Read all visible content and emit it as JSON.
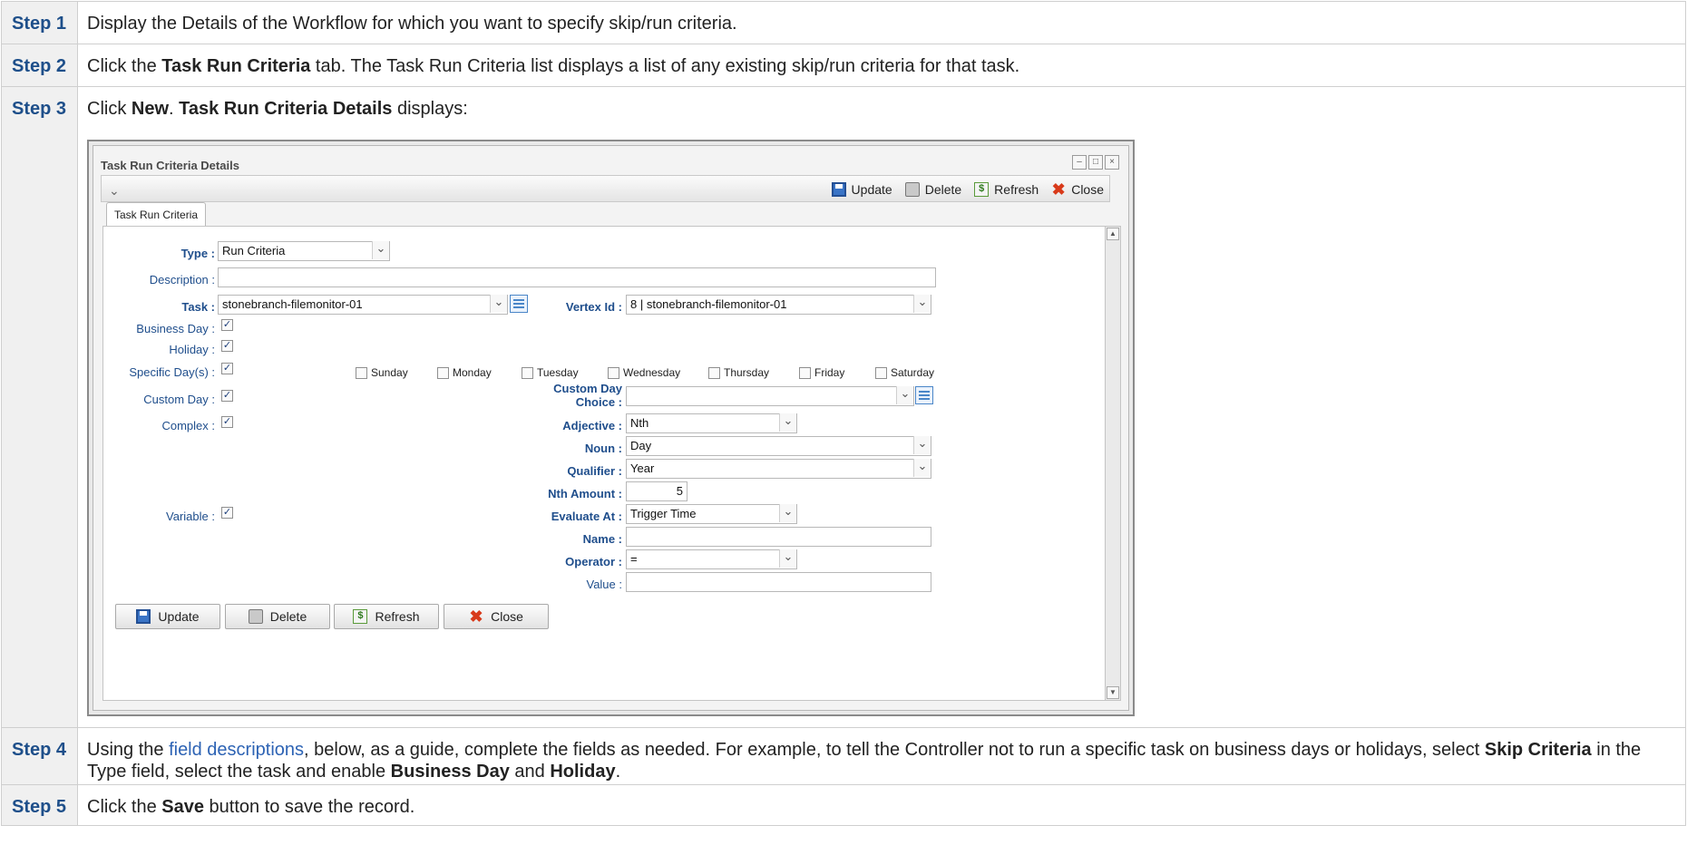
{
  "steps": [
    {
      "label": "Step 1",
      "text": "Display the Details of the Workflow for which you want to specify skip/run criteria."
    },
    {
      "label": "Step 2",
      "pre": "Click the ",
      "bold": "Task Run Criteria",
      "post": " tab. The Task Run Criteria list displays a list of any existing skip/run criteria for that task."
    },
    {
      "label": "Step 3",
      "pre": "Click ",
      "bold1": "New",
      "mid": ". ",
      "bold2": "Task Run Criteria Details",
      "post": " displays:"
    },
    {
      "label": "Step 4",
      "pre": "Using the ",
      "link": "field descriptions",
      "mid1": ", below, as a guide, complete the fields as needed. For example, to tell the Controller not to run a specific task on business days or holidays, select ",
      "bold1": "Skip Criteria",
      "mid2": " in the Type field, select the task and enable ",
      "bold2": "Business Day",
      "mid3": " and ",
      "bold3": "Holiday",
      "post": "."
    },
    {
      "label": "Step 5",
      "pre": "Click the ",
      "bold": "Save",
      "post": " button to save the record."
    }
  ],
  "window": {
    "title": "Task Run Criteria Details",
    "toolbar": {
      "update": "Update",
      "delete": "Delete",
      "refresh": "Refresh",
      "close": "Close"
    },
    "tab": "Task Run Criteria",
    "fields": {
      "type_label": "Type :",
      "type_value": "Run Criteria",
      "description_label": "Description :",
      "description_value": "",
      "task_label": "Task :",
      "task_value": "stonebranch-filemonitor-01",
      "vertex_label": "Vertex Id :",
      "vertex_value": "8 | stonebranch-filemonitor-01",
      "business_day_label": "Business Day :",
      "holiday_label": "Holiday :",
      "specific_days_label": "Specific Day(s) :",
      "days": [
        "Sunday",
        "Monday",
        "Tuesday",
        "Wednesday",
        "Thursday",
        "Friday",
        "Saturday"
      ],
      "custom_day_label": "Custom Day :",
      "custom_day_choice_label_1": "Custom Day",
      "custom_day_choice_label_2": "Choice :",
      "custom_day_choice_value": "",
      "complex_label": "Complex :",
      "adjective_label": "Adjective :",
      "adjective_value": "Nth",
      "noun_label": "Noun :",
      "noun_value": "Day",
      "qualifier_label": "Qualifier :",
      "qualifier_value": "Year",
      "nth_amount_label": "Nth Amount :",
      "nth_amount_value": "5",
      "variable_label": "Variable :",
      "evaluate_at_label": "Evaluate At :",
      "evaluate_at_value": "Trigger Time",
      "name_label": "Name :",
      "name_value": "",
      "operator_label": "Operator :",
      "operator_value": "=",
      "value_label": "Value :",
      "value_value": ""
    },
    "checked": {
      "business_day": true,
      "holiday": true,
      "specific_days": true,
      "custom_day": true,
      "complex": true,
      "variable": true
    },
    "bottom_buttons": {
      "update": "Update",
      "delete": "Delete",
      "refresh": "Refresh",
      "close": "Close"
    }
  }
}
